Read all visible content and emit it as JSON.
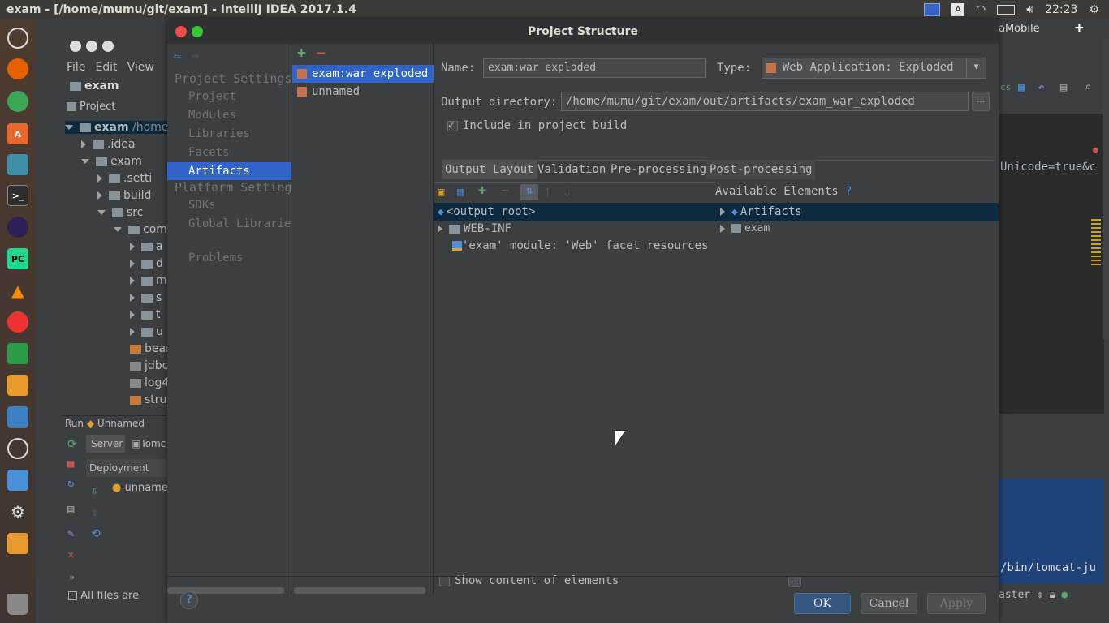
{
  "topbar": {
    "title": "exam - [/home/mumu/git/exam] - IntelliJ IDEA 2017.1.4",
    "time": "22:23"
  },
  "ide": {
    "menu": [
      "File",
      "Edit",
      "View"
    ],
    "breadcrumb": "exam",
    "project_label": "Project",
    "tree": [
      {
        "label": ".idea"
      },
      {
        "label": "exam"
      },
      {
        "label": ".setti"
      },
      {
        "label": "build"
      },
      {
        "label": "src"
      },
      {
        "label": "com."
      },
      {
        "label": "a"
      },
      {
        "label": "d"
      },
      {
        "label": "m"
      },
      {
        "label": "s"
      },
      {
        "label": "t"
      },
      {
        "label": "u"
      },
      {
        "label": "bear"
      },
      {
        "label": "jdbc"
      },
      {
        "label": "log4"
      },
      {
        "label": "stru"
      }
    ],
    "root_label": "exam",
    "root_path": "/home.",
    "run_label": "Run",
    "run_config": "Unnamed",
    "server_tab": "Server",
    "tomcat_tab": "Tomc",
    "deployment_label": "Deployment",
    "deploy_item": "unname",
    "status_text": "All files are",
    "right_tab": "aMobile",
    "editor_snippet": "Unicode=true&c",
    "console_snippet": "/bin/tomcat-ju",
    "git_branch": "aster"
  },
  "dialog": {
    "title": "Project Structure",
    "nav": {
      "project_settings_header": "Project Settings",
      "project": "Project",
      "modules": "Modules",
      "libraries": "Libraries",
      "facets": "Facets",
      "artifacts": "Artifacts",
      "platform_settings_header": "Platform Setting",
      "sdks": "SDKs",
      "global_libraries": "Global Libraries",
      "problems": "Problems"
    },
    "artifacts": [
      "exam:war exploded",
      "unnamed"
    ],
    "name_label": "Name:",
    "name_value": "exam:war exploded",
    "type_label": "Type:",
    "type_value": "Web Application: Exploded",
    "output_dir_label": "Output directory:",
    "output_dir_value": "/home/mumu/git/exam/out/artifacts/exam_war_exploded",
    "browse_label": "...",
    "include_label": "Include in project build",
    "tabs": [
      "Output Layout",
      "Validation",
      "Pre-processing",
      "Post-processing"
    ],
    "available_label": "Available Elements",
    "help_mark": "?",
    "layout_tree": [
      "<output root>",
      "WEB-INF",
      "'exam' module: 'Web' facet resources"
    ],
    "available_tree": [
      "Artifacts",
      "exam"
    ],
    "show_content_label": "Show content of elements",
    "buttons": {
      "ok": "OK",
      "cancel": "Cancel",
      "apply": "Apply"
    }
  },
  "colors": {
    "selection": "#2f65ca",
    "dialog_bg": "#3c3f41",
    "primary_button": "#365880"
  }
}
